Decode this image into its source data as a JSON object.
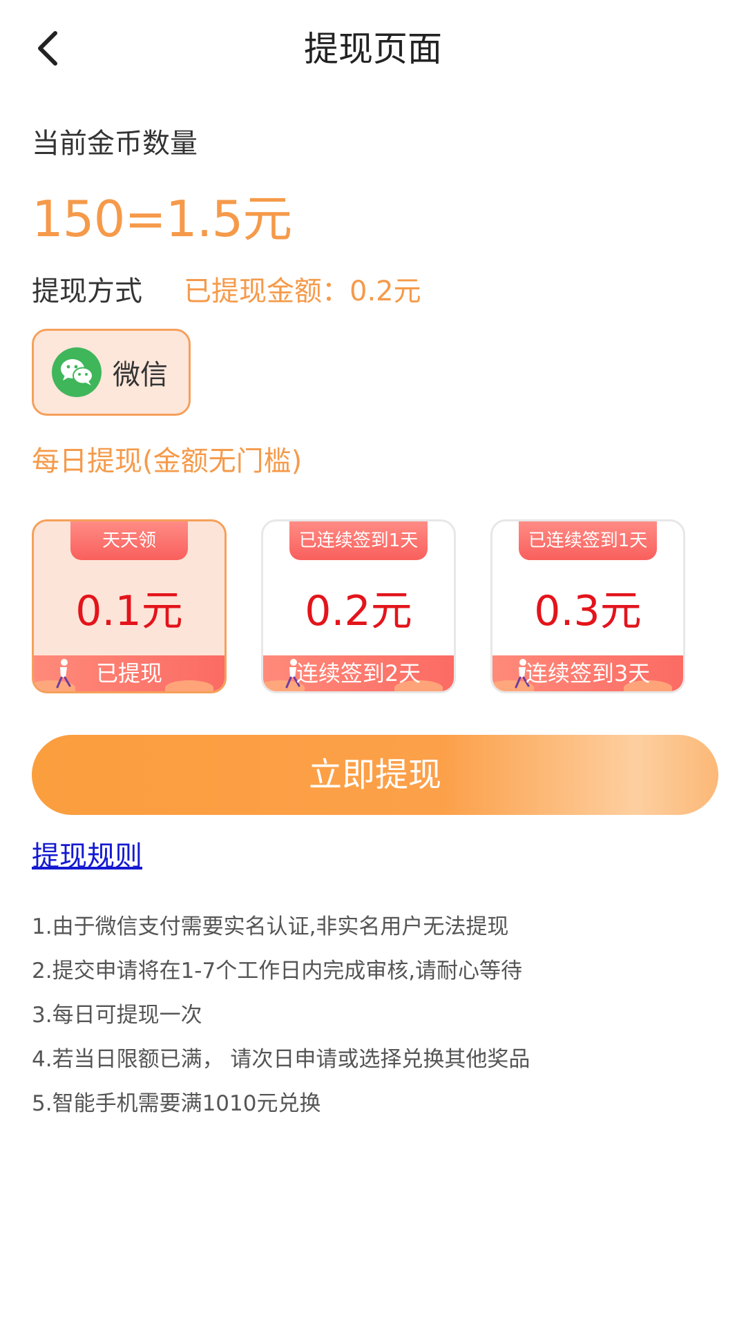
{
  "header": {
    "title": "提现页面",
    "back_icon": "chevron-left-icon"
  },
  "coins": {
    "label": "当前金币数量",
    "value": "150=1.5元"
  },
  "withdraw_method": {
    "label": "提现方式",
    "withdrawn_amount": "已提现金额：0.2元",
    "option": {
      "label": "微信",
      "icon": "wechat-icon"
    }
  },
  "daily": {
    "label": "每日提现(金额无门槛)"
  },
  "cards": [
    {
      "tag": "天天领",
      "amount": "0.1元",
      "footer": "已提现",
      "selected": true
    },
    {
      "tag": "已连续签到1天",
      "amount": "0.2元",
      "footer": "连续签到2天",
      "selected": false
    },
    {
      "tag": "已连续签到1天",
      "amount": "0.3元",
      "footer": "连续签到3天",
      "selected": false
    }
  ],
  "withdraw_button": {
    "label": "立即提现"
  },
  "rules": {
    "title": "提现规则",
    "items": [
      "1.由于微信支付需要实名认证,非实名用户无法提现",
      "2.提交申请将在1-7个工作日内完成审核,请耐心等待",
      "3.每日可提现一次",
      "4.若当日限额已满， 请次日申请或选择兑换其他奖品",
      "5.智能手机需要满1010元兑换"
    ]
  },
  "colors": {
    "accent_orange": "#f59a4a",
    "amount_red": "#e3141b",
    "link_blue": "#1419d1",
    "wechat_green": "#3fb65a"
  }
}
